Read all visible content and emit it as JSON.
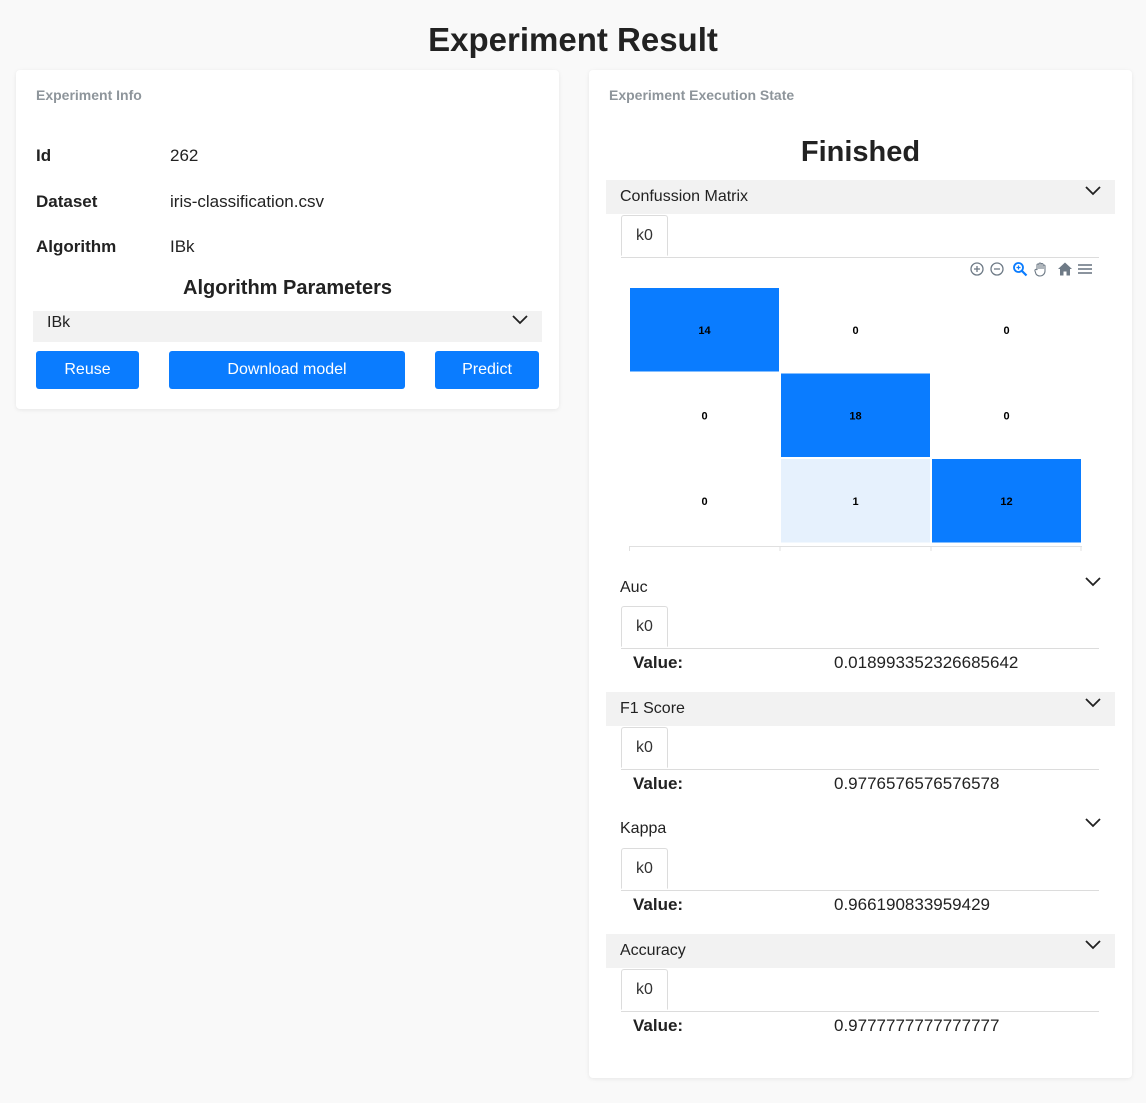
{
  "page": {
    "title": "Experiment Result"
  },
  "info": {
    "header": "Experiment Info",
    "rows": [
      {
        "label": "Id",
        "value": "262"
      },
      {
        "label": "Dataset",
        "value": "iris-classification.csv"
      },
      {
        "label": "Algorithm",
        "value": "IBk"
      }
    ],
    "params_title": "Algorithm Parameters",
    "params_accordion": "IBk",
    "buttons": {
      "reuse": "Reuse",
      "download": "Download model",
      "predict": "Predict"
    }
  },
  "execution": {
    "header": "Experiment Execution State",
    "state": "Finished",
    "sections": [
      {
        "title": "Confussion Matrix",
        "tab": "k0"
      },
      {
        "title": "Auc",
        "tab": "k0",
        "value_label": "Value:",
        "value": "0.018993352326685642"
      },
      {
        "title": "F1 Score",
        "tab": "k0",
        "value_label": "Value:",
        "value": "0.9776576576576578"
      },
      {
        "title": "Kappa",
        "tab": "k0",
        "value_label": "Value:",
        "value": "0.966190833959429"
      },
      {
        "title": "Accuracy",
        "tab": "k0",
        "value_label": "Value:",
        "value": "0.9777777777777777"
      }
    ],
    "chart_toolbar": [
      "zoom-in-icon",
      "zoom-out-icon",
      "zoom-selection-icon",
      "pan-hand-icon",
      "home-reset-icon",
      "menu-icon"
    ]
  },
  "chart_data": {
    "type": "heatmap",
    "title": "",
    "xlabel": "",
    "ylabel": "",
    "matrix": [
      [
        14,
        0,
        0
      ],
      [
        0,
        18,
        0
      ],
      [
        0,
        1,
        12
      ]
    ],
    "colors": {
      "high": "#0a7cff",
      "low": "#e6f1fd",
      "zero": "#ffffff"
    }
  }
}
